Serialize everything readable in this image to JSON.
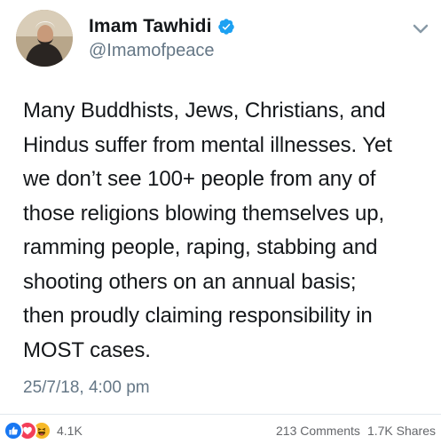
{
  "account": {
    "display_name": "Imam Tawhidi",
    "handle": "@Imamofpeace",
    "verified": true,
    "verified_color": "#1da1f2"
  },
  "tweet": {
    "text": "Many Buddhists, Jews, Christians, and\nHindus suffer from mental illnesses. Yet\nwe don’t see 100+ people from any of\nthose religions blowing themselves up,\nramming people, raping, stabbing and\nshooting others on an annual basis;\nthen proudly claiming responsibility in\nMOST cases.",
    "timestamp": "25/7/18, 4:00 pm"
  },
  "footer": {
    "reaction_icons": [
      "like-icon",
      "love-icon",
      "haha-icon"
    ],
    "reaction_count": "4.1K",
    "comments": "213 Comments",
    "shares": "1.7K Shares"
  },
  "colors": {
    "text": "#14171a",
    "muted": "#657786",
    "like": "#1877f2",
    "love": "#f33e58",
    "haha": "#f7b928"
  }
}
